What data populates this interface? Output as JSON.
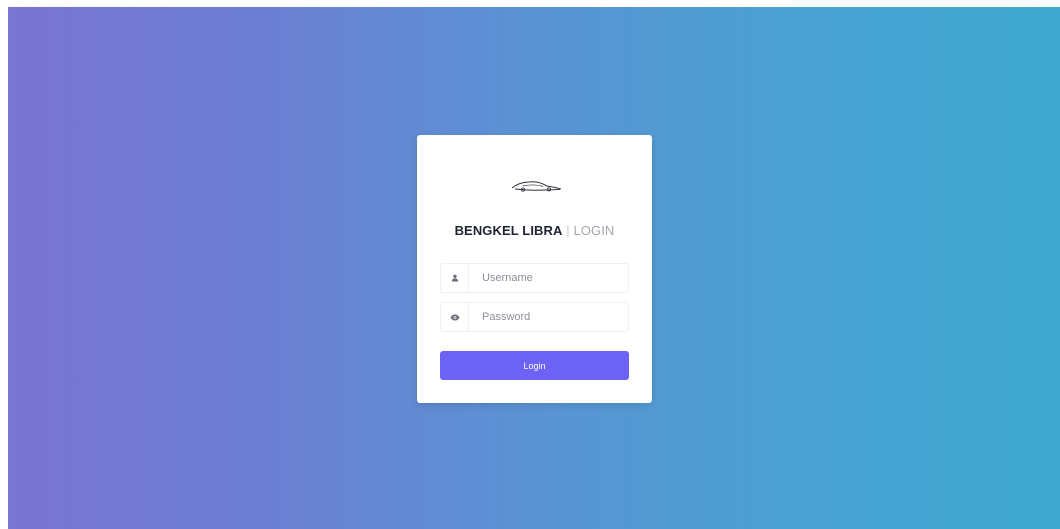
{
  "login": {
    "brand": "BENGKEL LIBRA",
    "separator": "|",
    "subtitle": "LOGIN",
    "username": {
      "value": "",
      "placeholder": "Username",
      "icon": "user-icon"
    },
    "password": {
      "value": "",
      "placeholder": "Password",
      "icon": "eye-icon"
    },
    "button_label": "Login",
    "logo_icon": "car-icon"
  },
  "colors": {
    "gradient_start": "#7a74d2",
    "gradient_end": "#3ea8d1",
    "button": "#6c63f5",
    "brand_text": "#1f2430",
    "subtitle_text": "#a3a7b0"
  }
}
